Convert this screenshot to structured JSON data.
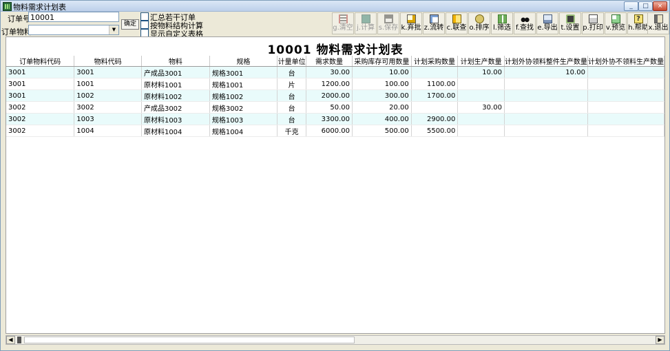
{
  "window": {
    "title": "物料需求计划表"
  },
  "form": {
    "order_no_label": "订单号",
    "order_no_value": "10001",
    "order_material_label": "订单物料",
    "order_material_value": "",
    "confirm_label": "确定",
    "options": [
      {
        "label": "汇总若干订单",
        "checked": false
      },
      {
        "label": "按物料结构计算",
        "checked": false
      },
      {
        "label": "显示自定义表格",
        "checked": false
      }
    ]
  },
  "toolbar": [
    {
      "label": "g.清空",
      "icon": "clear-icon",
      "enabled": false
    },
    {
      "label": "j.计算",
      "icon": "calculate-icon",
      "enabled": false
    },
    {
      "label": "s.保存",
      "icon": "save-icon",
      "enabled": false
    },
    {
      "label": "k.弃批",
      "icon": "discard-batch-icon",
      "enabled": true
    },
    {
      "label": "z.流转",
      "icon": "transfer-icon",
      "enabled": true
    },
    {
      "label": "c.联查",
      "icon": "linked-query-icon",
      "enabled": true
    },
    {
      "label": "o.排序",
      "icon": "sort-icon",
      "enabled": true
    },
    {
      "label": "l.筛选",
      "icon": "filter-icon",
      "enabled": true
    },
    {
      "label": "f.查找",
      "icon": "binoculars-icon",
      "enabled": true
    },
    {
      "label": "e.导出",
      "icon": "export-icon",
      "enabled": true
    },
    {
      "label": "t.设置",
      "icon": "settings-icon",
      "enabled": true
    },
    {
      "label": "p.打印",
      "icon": "printer-icon",
      "enabled": true
    },
    {
      "label": "v.预览",
      "icon": "preview-icon",
      "enabled": true
    },
    {
      "label": "h.帮助",
      "icon": "help-icon",
      "enabled": true
    },
    {
      "label": "x.退出",
      "icon": "exit-icon",
      "enabled": true
    }
  ],
  "report": {
    "title": "10001  物料需求计划表",
    "columns": [
      "订单物料代码",
      "物料代码",
      "物料",
      "规格",
      "计量单位",
      "需求数量",
      "采购库存可用数量",
      "计划采购数量",
      "计划生产数量",
      "计划外协领料整件生产数量",
      "计划外协不领料生产数量"
    ],
    "rows": [
      [
        "3001",
        "3001",
        "产成品3001",
        "规格3001",
        "台",
        "30.00",
        "10.00",
        "",
        "10.00",
        "10.00",
        ""
      ],
      [
        "3001",
        "1001",
        "原材料1001",
        "规格1001",
        "片",
        "1200.00",
        "100.00",
        "1100.00",
        "",
        "",
        ""
      ],
      [
        "3001",
        "1002",
        "原材料1002",
        "规格1002",
        "台",
        "2000.00",
        "300.00",
        "1700.00",
        "",
        "",
        ""
      ],
      [
        "3002",
        "3002",
        "产成品3002",
        "规格3002",
        "台",
        "50.00",
        "20.00",
        "",
        "30.00",
        "",
        ""
      ],
      [
        "3002",
        "1003",
        "原材料1003",
        "规格1003",
        "台",
        "3300.00",
        "400.00",
        "2900.00",
        "",
        "",
        ""
      ],
      [
        "3002",
        "1004",
        "原材料1004",
        "规格1004",
        "千克",
        "6000.00",
        "500.00",
        "5500.00",
        "",
        "",
        ""
      ]
    ]
  },
  "icons": {
    "scroll_left": "◀",
    "scroll_right": "▶",
    "combo_arrow": "▼",
    "minimize": "_",
    "maximize": "□",
    "close": "×"
  }
}
